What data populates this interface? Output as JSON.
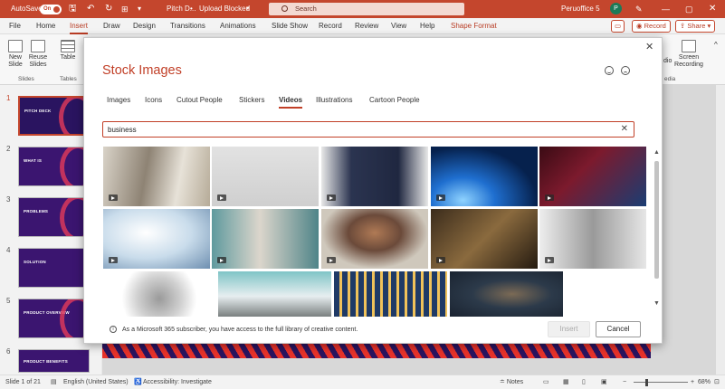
{
  "titlebar": {
    "autosave_label": "AutoSave",
    "autosave_state": "On",
    "filename": "Pitch D...",
    "upload_status": "Upload Blocked",
    "search_placeholder": "Search",
    "user_name": "Peruoffice 5",
    "user_initial": "P",
    "bg_color": "#c4462d"
  },
  "menubar": {
    "tabs": [
      "File",
      "Home",
      "Insert",
      "Draw",
      "Design",
      "Transitions",
      "Animations",
      "Slide Show",
      "Record",
      "Review",
      "View",
      "Help",
      "Shape Format"
    ],
    "active_tab": "Insert",
    "record_button": "Record",
    "share_button": "Share"
  },
  "ribbon": {
    "new_slide": "New Slide",
    "reuse_slides": "Reuse Slides",
    "table": "Table",
    "slides_group": "Slides",
    "tables_group": "Tables",
    "right_partial_1": "dio",
    "screen_recording": "Screen Recording",
    "media_group": "edia"
  },
  "slides_panel": {
    "slide_numbers": [
      "1",
      "2",
      "3",
      "4",
      "5",
      "6"
    ],
    "slide_titles": [
      "PITCH DECK",
      "WHAT IS",
      "PROBLEMS",
      "SOLUTION",
      "PRODUCT OVERVIEW",
      "PRODUCT BENEFITS"
    ]
  },
  "dialog": {
    "title": "Stock Images",
    "tabs": [
      "Images",
      "Icons",
      "Cutout People",
      "Stickers",
      "Videos",
      "Illustrations",
      "Cartoon People"
    ],
    "active_tab": "Videos",
    "search_value": "business",
    "info_text": "As a Microsoft 365 subscriber, you have access to the full library of creative content.",
    "insert_button": "Insert",
    "cancel_button": "Cancel",
    "accent_color": "#c13f27"
  },
  "statusbar": {
    "slide_info": "Slide 1 of 21",
    "language": "English (United States)",
    "accessibility": "Accessibility: Investigate",
    "notes": "Notes",
    "zoom": "68%"
  }
}
